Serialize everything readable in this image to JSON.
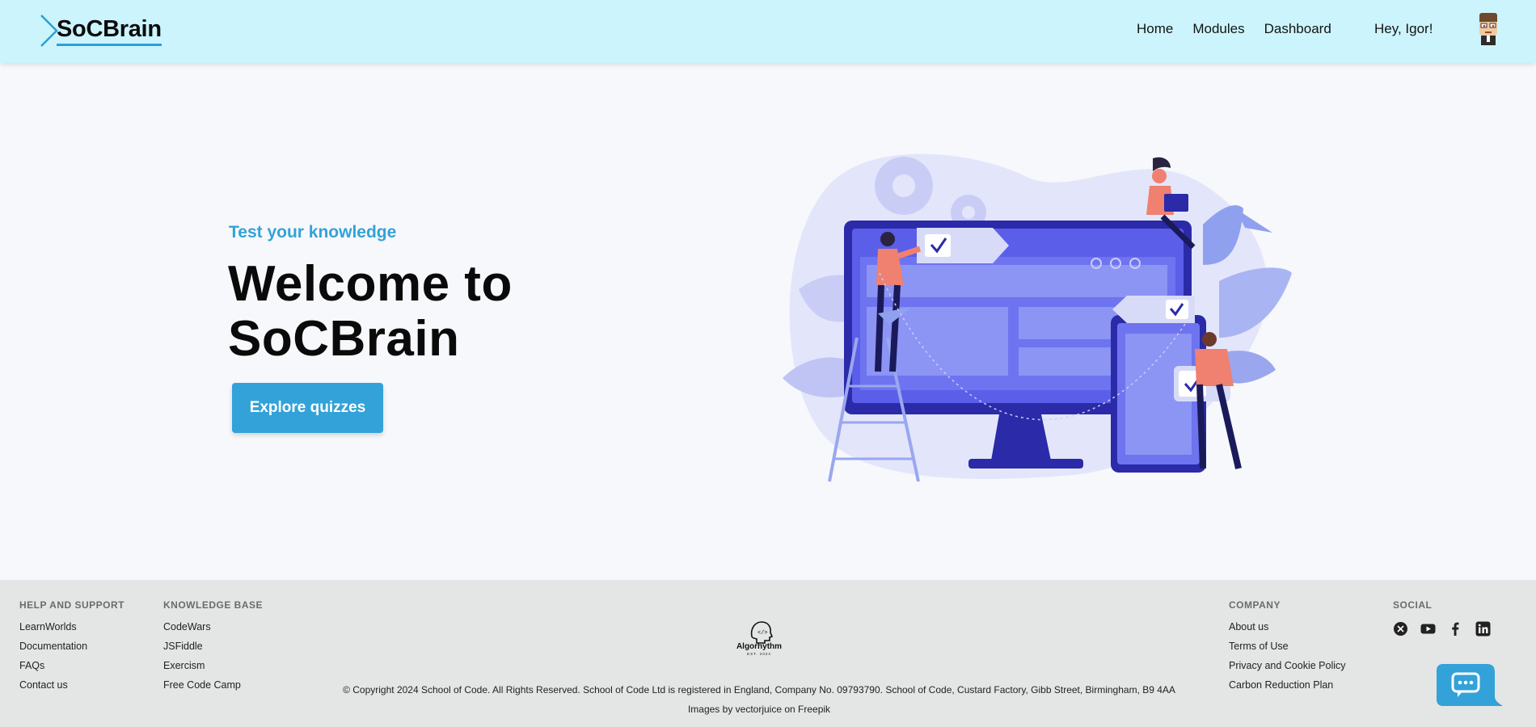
{
  "header": {
    "brand": "SoCBrain",
    "nav": [
      "Home",
      "Modules",
      "Dashboard"
    ],
    "greeting": "Hey, Igor!",
    "avatar_icon": "cartoon-avatar-icon"
  },
  "hero": {
    "subtitle": "Test your knowledge",
    "title": "Welcome to SoCBrain",
    "cta": "Explore quizzes",
    "illustration_icon": "developers-illustration"
  },
  "footer": {
    "help": {
      "heading": "HELP AND SUPPORT",
      "links": [
        "LearnWorlds",
        "Documentation",
        "FAQs",
        "Contact us"
      ]
    },
    "knowledge": {
      "heading": "KNOWLEDGE BASE",
      "links": [
        "CodeWars",
        "JSFiddle",
        "Exercism",
        "Free Code Camp"
      ]
    },
    "company": {
      "heading": "COMPANY",
      "links": [
        "About us",
        "Terms of Use",
        "Privacy and Cookie Policy",
        "Carbon Reduction Plan"
      ]
    },
    "social": {
      "heading": "SOCIAL",
      "icons": [
        "x-icon",
        "youtube-icon",
        "facebook-icon",
        "linkedin-icon"
      ]
    },
    "center_logo": {
      "name": "Algorhythm",
      "tagline": "EST. 2024"
    },
    "copyright": "© Copyright 2024 School of Code. All Rights Reserved. School of Code Ltd is registered in England, Company No. 09793790. School of Code, Custard Factory, Gibb Street, Birmingham, B9 4AA",
    "credits": "Images by vectorjuice on Freepik"
  },
  "colors": {
    "header_bg": "#ccf4fd",
    "accent": "#33a2d9",
    "page_bg": "#f7f8fb",
    "footer_bg": "#e4e5e5",
    "illustration_primary": "#5b5ee8"
  }
}
